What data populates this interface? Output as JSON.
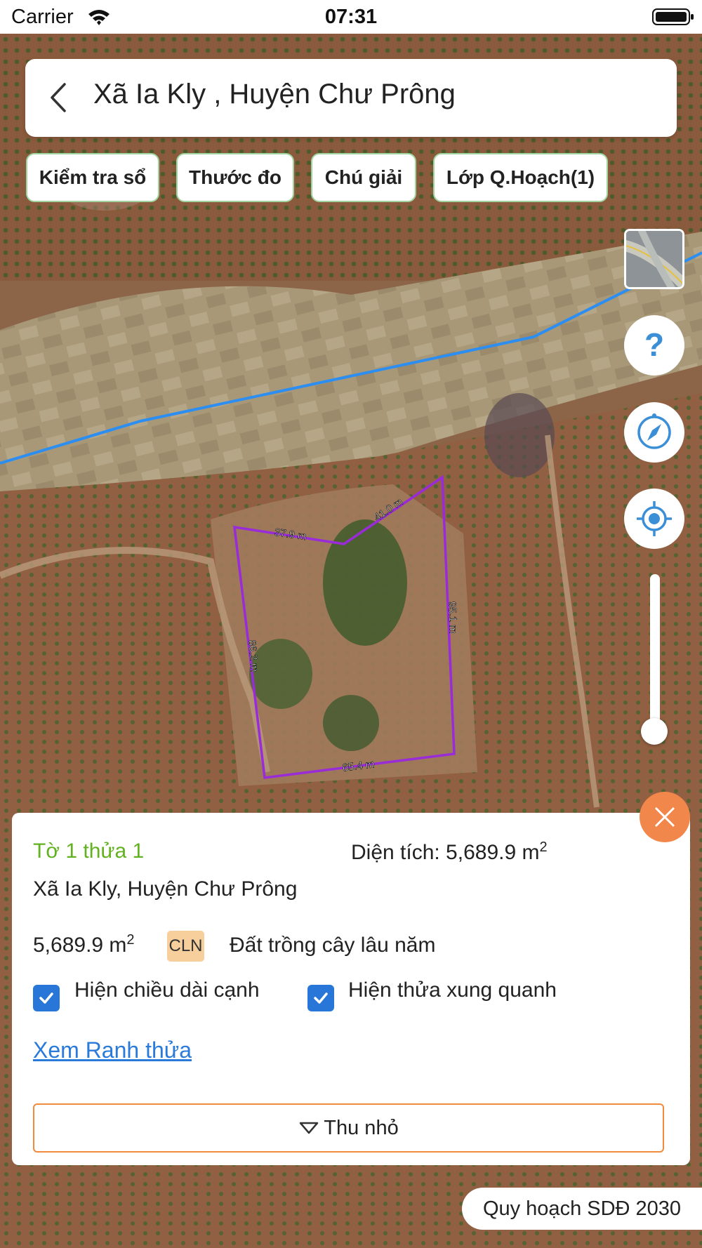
{
  "status_bar": {
    "carrier": "Carrier",
    "time": "07:31"
  },
  "header": {
    "title": "Xã Ia Kly , Huyện Chư Prông"
  },
  "toolbar": {
    "chips": [
      "Kiểm tra sổ",
      "Thước đo",
      "Chú giải",
      "Lớp Q.Hoạch(1)"
    ]
  },
  "map": {
    "edge_labels": [
      "37.9 m",
      "41.0 m",
      "95.1 m",
      "86.2 m",
      "65.4 m"
    ],
    "controls": [
      "layer-switcher",
      "help-icon",
      "compass-icon",
      "locate-icon",
      "zoom-slider"
    ]
  },
  "panel": {
    "parcel_id": "Tờ 1 thửa 1",
    "area_label": "Diện tích: 5,689.9 m",
    "area_unit_sup": "2",
    "location": "Xã Ia Kly, Huyện Chư Prông",
    "land_area": "5,689.9 m",
    "land_area_sup": "2",
    "land_code": "CLN",
    "land_type": "Đất trồng cây lâu năm",
    "show_edge_length_label": "Hiện chiều dài cạnh",
    "show_edge_length_checked": true,
    "show_neighbors_label": "Hiện thửa xung quanh",
    "show_neighbors_checked": true,
    "boundary_link": "Xem Ranh thửa",
    "collapse_label": "Thu nhỏ"
  },
  "footer": {
    "plan_badge": "Quy hoạch SDĐ 2030"
  },
  "colors": {
    "accent_green": "#62b120",
    "chip_border": "#9fd49f",
    "checkbox_blue": "#2877d8",
    "link_blue": "#2a7ad9",
    "close_orange": "#f2874c",
    "collapse_border": "#f08a3c",
    "land_code_bg": "#f6cf9c",
    "parcel_outline": "#9a2bd8",
    "road_line": "#2b8ef0",
    "control_icon_blue": "#3b8fd6"
  }
}
